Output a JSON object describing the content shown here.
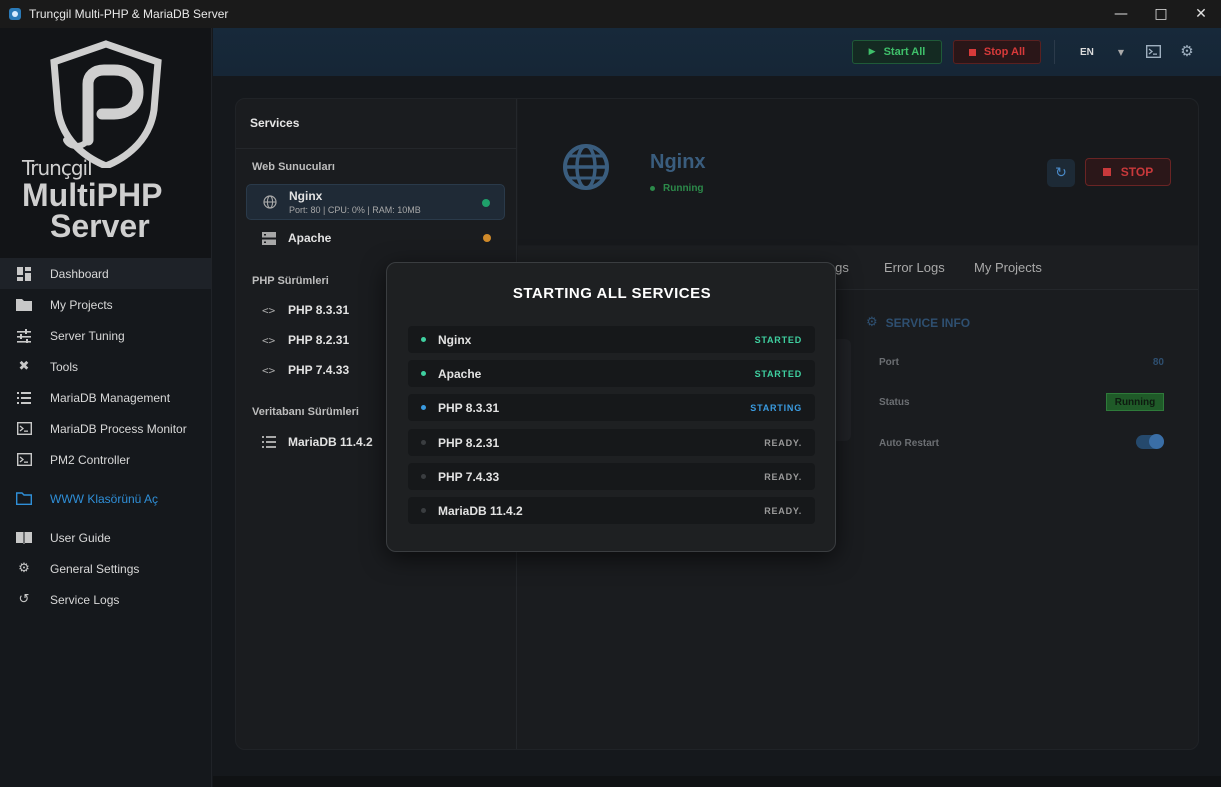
{
  "window": {
    "title": "Trunçgil Multi-PHP & MariaDB Server"
  },
  "logo": {
    "line1": "Trunçgil",
    "line2": "MultiPHP",
    "line3": "Server"
  },
  "sidebar": {
    "items": [
      {
        "label": "Dashboard",
        "icon": "dashboard-icon"
      },
      {
        "label": "My Projects",
        "icon": "folder-icon"
      },
      {
        "label": "Server Tuning",
        "icon": "sliders-icon"
      },
      {
        "label": "Tools",
        "icon": "tools-icon"
      },
      {
        "label": "MariaDB Management",
        "icon": "list-icon"
      },
      {
        "label": "MariaDB Process Monitor",
        "icon": "terminal-icon"
      },
      {
        "label": "PM2 Controller",
        "icon": "terminal-icon"
      },
      {
        "label": "WWW Klasörünü Aç",
        "icon": "folder-outline-icon"
      },
      {
        "label": "User Guide",
        "icon": "book-icon"
      },
      {
        "label": "General Settings",
        "icon": "gear-icon"
      },
      {
        "label": "Service Logs",
        "icon": "history-icon"
      }
    ]
  },
  "header": {
    "start_all": "Start All",
    "stop_all": "Stop All",
    "language": "EN"
  },
  "services_panel": {
    "title": "Services",
    "groups": {
      "web": "Web Sunucuları",
      "php": "PHP Sürümleri",
      "db": "Veritabanı Sürümleri"
    },
    "web": [
      {
        "name": "Nginx",
        "sub": "Port: 80 | CPU: 0% | RAM: 10MB"
      },
      {
        "name": "Apache"
      }
    ],
    "php": [
      {
        "name": "PHP 8.3.31"
      },
      {
        "name": "PHP 8.2.31"
      },
      {
        "name": "PHP 7.4.33"
      }
    ],
    "db": [
      {
        "name": "MariaDB 11.4.2"
      }
    ]
  },
  "detail": {
    "name": "Nginx",
    "status": "Running",
    "stop_label": "STOP",
    "tabs": [
      "ings",
      "Error Logs",
      "My Projects"
    ],
    "info_title": "SERVICE INFO",
    "port_label": "Port",
    "port_value": "80",
    "status_label": "Status",
    "status_value": "Running",
    "auto_restart_label": "Auto Restart",
    "auto_restart_on": true
  },
  "modal": {
    "title": "STARTING ALL SERVICES",
    "rows": [
      {
        "name": "Nginx",
        "state": "STARTED"
      },
      {
        "name": "Apache",
        "state": "STARTED"
      },
      {
        "name": "PHP 8.3.31",
        "state": "STARTING"
      },
      {
        "name": "PHP 8.2.31",
        "state": "READY."
      },
      {
        "name": "PHP 7.4.33",
        "state": "READY."
      },
      {
        "name": "MariaDB 11.4.2",
        "state": "READY."
      }
    ]
  },
  "colors": {
    "started": "#3fd0a0",
    "starting": "#3a9be0",
    "ready": "#9a9a9a",
    "running_green": "#2c8a4a",
    "stop_red": "#c8393b",
    "accent_blue": "#2f8fd8",
    "dot_green": "#1fa06a",
    "dot_orange": "#d08a2a"
  }
}
